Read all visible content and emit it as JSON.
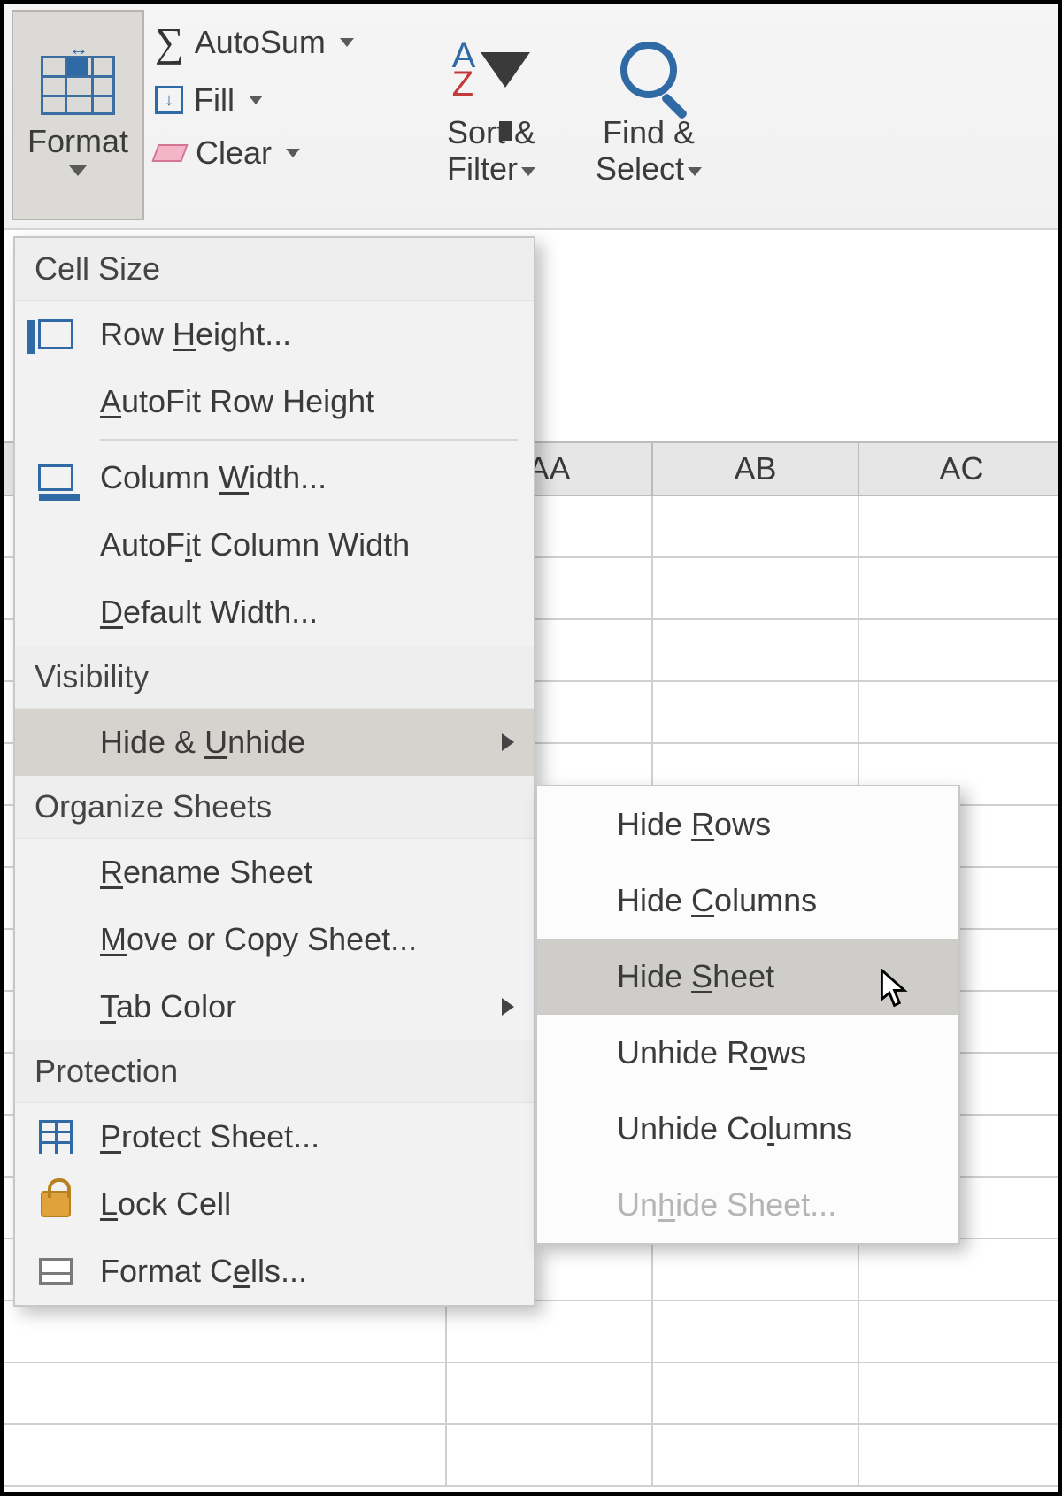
{
  "ribbon": {
    "format_label": "Format",
    "autosum_label": "AutoSum",
    "fill_label": "Fill",
    "clear_label": "Clear",
    "sort_line1": "Sort &",
    "sort_line2": "Filter",
    "find_line1": "Find &",
    "find_line2": "Select"
  },
  "columns": [
    "AA",
    "AB",
    "AC"
  ],
  "menu": {
    "sec_cell_size": "Cell Size",
    "row_height_pre": "Row ",
    "row_height_u": "H",
    "row_height_post": "eight...",
    "autofit_row_pre": "",
    "autofit_row_u": "A",
    "autofit_row_post": "utoFit Row Height",
    "col_width_pre": "Column ",
    "col_width_u": "W",
    "col_width_post": "idth...",
    "autofit_col_pre": "AutoF",
    "autofit_col_u": "i",
    "autofit_col_post": "t Column Width",
    "default_width_pre": "",
    "default_width_u": "D",
    "default_width_post": "efault Width...",
    "sec_visibility": "Visibility",
    "hide_unhide_pre": "Hide & ",
    "hide_unhide_u": "U",
    "hide_unhide_post": "nhide",
    "sec_organize": "Organize Sheets",
    "rename_pre": "",
    "rename_u": "R",
    "rename_post": "ename Sheet",
    "move_pre": "",
    "move_u": "M",
    "move_post": "ove or Copy Sheet...",
    "tab_color_pre": "",
    "tab_color_u": "T",
    "tab_color_post": "ab Color",
    "sec_protection": "Protection",
    "protect_pre": "",
    "protect_u": "P",
    "protect_post": "rotect Sheet...",
    "lock_pre": "",
    "lock_u": "L",
    "lock_post": "ock Cell",
    "format_cells_pre": "Format C",
    "format_cells_u": "e",
    "format_cells_post": "lls..."
  },
  "submenu": {
    "hide_rows_pre": "Hide ",
    "hide_rows_u": "R",
    "hide_rows_post": "ows",
    "hide_cols_pre": "Hide ",
    "hide_cols_u": "C",
    "hide_cols_post": "olumns",
    "hide_sheet_pre": "Hide ",
    "hide_sheet_u": "S",
    "hide_sheet_post": "heet",
    "unhide_rows_pre": "Unhide R",
    "unhide_rows_u": "o",
    "unhide_rows_post": "ws",
    "unhide_cols_pre": "Unhide Co",
    "unhide_cols_u": "l",
    "unhide_cols_post": "umns",
    "unhide_sheet_pre": "Un",
    "unhide_sheet_u": "h",
    "unhide_sheet_post": "ide Sheet..."
  }
}
